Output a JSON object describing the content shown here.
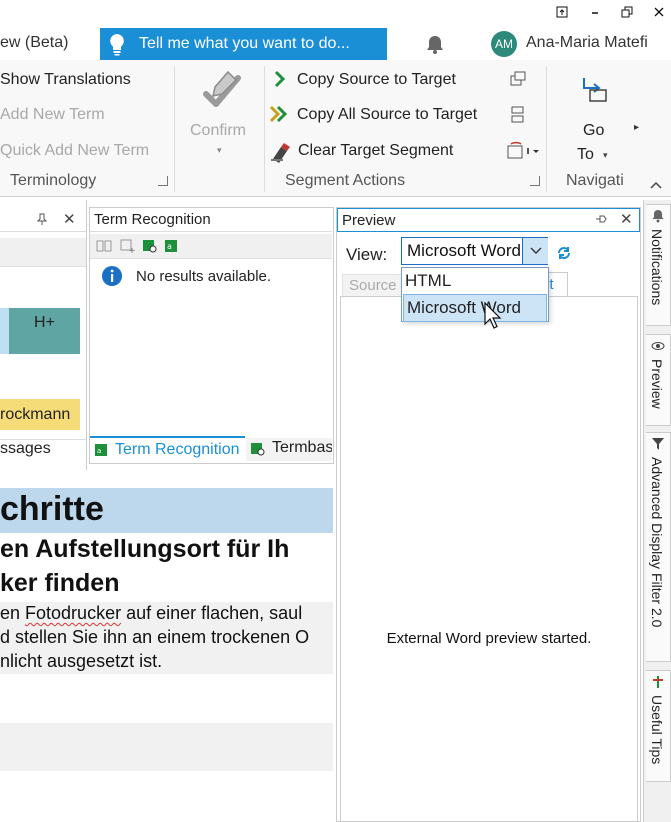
{
  "window": {
    "restore_icon": "restore-icon",
    "minimize_icon": "minimize-icon",
    "maximize_icon": "maximize-icon",
    "close_icon": "close-icon"
  },
  "menubar": {
    "view_beta": "ew (Beta)",
    "tell_me": "Tell me what you want to do...",
    "user_initials": "AM",
    "user_name": "Ana-Maria Matefi"
  },
  "ribbon": {
    "terminology": {
      "items": [
        "Show Translations",
        "Add New Term",
        "Quick Add New Term"
      ],
      "label": "Terminology"
    },
    "confirm": {
      "label": "Confirm"
    },
    "segment_actions": {
      "items": [
        "Copy Source to Target",
        "Copy All Source to Target",
        "Clear Target Segment"
      ],
      "label": "Segment Actions"
    },
    "navigation": {
      "go_to_line1": "Go",
      "go_to_line2": "To",
      "label": "Navigati"
    }
  },
  "left_panel": {
    "cell_text": "H+",
    "name_text": "rockmann",
    "tab_label": "ssages"
  },
  "term_panel": {
    "title": "Term Recognition",
    "message": "No results available.",
    "tabs": [
      "Term Recognition",
      "Termbas"
    ]
  },
  "preview_panel": {
    "title": "Preview",
    "view_label": "View:",
    "selected_value": "Microsoft Word",
    "options": [
      "HTML",
      "Microsoft Word"
    ],
    "tabs": [
      "Source",
      "et"
    ],
    "status": "External Word preview started."
  },
  "sidebar": {
    "tabs": [
      "Notifications",
      "Preview",
      "Advanced Display Filter 2.0",
      "Useful Tips"
    ]
  },
  "editor": {
    "heading1": "chritte",
    "heading2_line1": "en Aufstellungsort für Ih",
    "heading2_line2": "ker finden",
    "body_line1_pre": "en ",
    "body_line1_word": "Fotodrucker",
    "body_line1_post": " auf einer flachen, saul",
    "body_line2": "d stellen Sie ihn an einem trockenen O",
    "body_line3": "nlicht ausgesetzt ist."
  },
  "colors": {
    "accent": "#1b8fd6",
    "teal_cell": "#5fa5a3",
    "yellow_cell": "#f6dc78",
    "heading_band": "#bdd7ec"
  }
}
